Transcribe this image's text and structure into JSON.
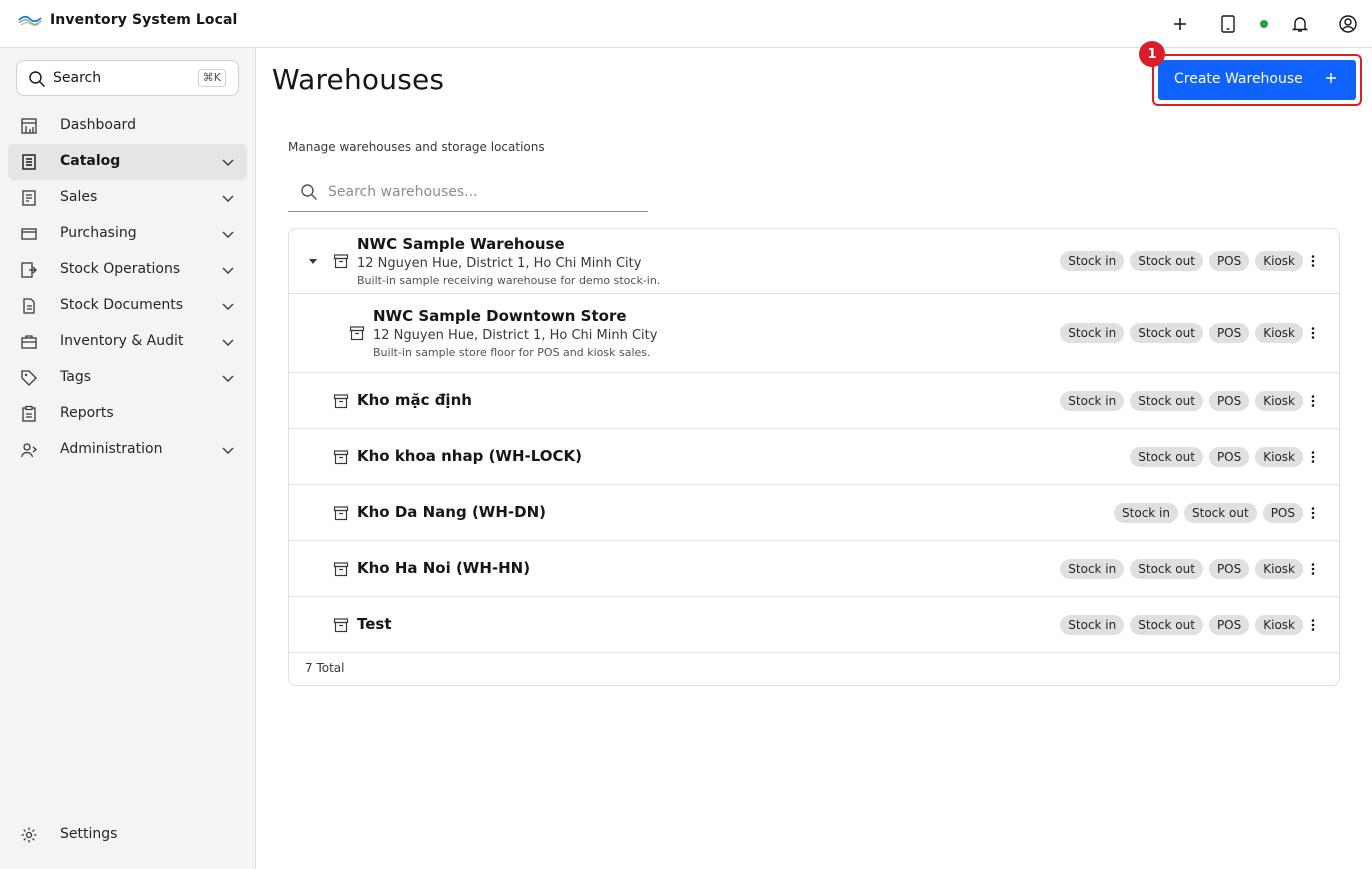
{
  "app": {
    "title": "Inventory System Local"
  },
  "header_icons": [
    "plus-icon",
    "tablet-icon",
    "status-dot",
    "bell-icon",
    "user-avatar-icon"
  ],
  "colors": {
    "accent": "#0f62fe",
    "highlight": "#da1e28",
    "status": "#24a148"
  },
  "sidebar": {
    "search_label": "Search",
    "search_shortcut": "⌘K",
    "items": [
      {
        "label": "Dashboard",
        "icon": "dashboard-icon",
        "expandable": false,
        "active": false
      },
      {
        "label": "Catalog",
        "icon": "catalog-icon",
        "expandable": true,
        "active": true
      },
      {
        "label": "Sales",
        "icon": "sales-icon",
        "expandable": true,
        "active": false
      },
      {
        "label": "Purchasing",
        "icon": "credit-card-icon",
        "expandable": true,
        "active": false
      },
      {
        "label": "Stock Operations",
        "icon": "stock-operations-icon",
        "expandable": true,
        "active": false
      },
      {
        "label": "Stock Documents",
        "icon": "document-icon",
        "expandable": true,
        "active": false
      },
      {
        "label": "Inventory & Audit",
        "icon": "briefcase-icon",
        "expandable": true,
        "active": false
      },
      {
        "label": "Tags",
        "icon": "tag-icon",
        "expandable": true,
        "active": false
      },
      {
        "label": "Reports",
        "icon": "report-icon",
        "expandable": false,
        "active": false
      },
      {
        "label": "Administration",
        "icon": "admin-icon",
        "expandable": true,
        "active": false
      }
    ],
    "settings_label": "Settings"
  },
  "main": {
    "title": "Warehouses",
    "create_button_label": "Create Warehouse",
    "annotation_number": "1",
    "subtitle": "Manage warehouses and storage locations",
    "search_placeholder": "Search warehouses...",
    "rows": [
      {
        "name": "NWC Sample Warehouse",
        "address": "12 Nguyen Hue, District 1, Ho Chi Minh City",
        "description": "Built-in sample receiving warehouse for demo stock-in.",
        "tags": [
          "Stock in",
          "Stock out",
          "POS",
          "Kiosk"
        ],
        "expanded": true,
        "child": false
      },
      {
        "name": "NWC Sample Downtown Store",
        "address": "12 Nguyen Hue, District 1, Ho Chi Minh City",
        "description": "Built-in sample store floor for POS and kiosk sales.",
        "tags": [
          "Stock in",
          "Stock out",
          "POS",
          "Kiosk"
        ],
        "expanded": false,
        "child": true
      },
      {
        "name": "Kho mặc định",
        "address": "",
        "description": "",
        "tags": [
          "Stock in",
          "Stock out",
          "POS",
          "Kiosk"
        ],
        "expanded": false,
        "child": false
      },
      {
        "name": "Kho khoa nhap (WH-LOCK)",
        "address": "",
        "description": "",
        "tags": [
          "Stock out",
          "POS",
          "Kiosk"
        ],
        "expanded": false,
        "child": false
      },
      {
        "name": "Kho Da Nang (WH-DN)",
        "address": "",
        "description": "",
        "tags": [
          "Stock in",
          "Stock out",
          "POS"
        ],
        "expanded": false,
        "child": false
      },
      {
        "name": "Kho Ha Noi (WH-HN)",
        "address": "",
        "description": "",
        "tags": [
          "Stock in",
          "Stock out",
          "POS",
          "Kiosk"
        ],
        "expanded": false,
        "child": false
      },
      {
        "name": "Test",
        "address": "",
        "description": "",
        "tags": [
          "Stock in",
          "Stock out",
          "POS",
          "Kiosk"
        ],
        "expanded": false,
        "child": false
      }
    ],
    "total_label": "7 Total"
  }
}
